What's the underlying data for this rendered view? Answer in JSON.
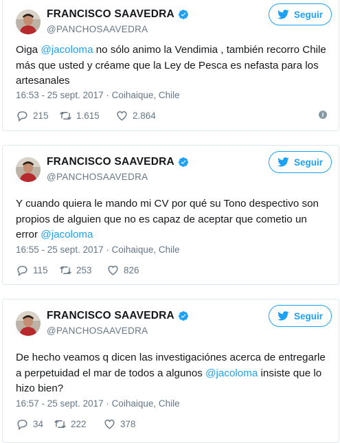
{
  "colors": {
    "accent": "#1da1f2",
    "muted": "#657786",
    "text": "#14171a",
    "border": "#e1e8ed"
  },
  "tweets": [
    {
      "name": "FRANCISCO SAAVEDRA",
      "handle": "@PANCHOSAAVEDRA",
      "follow_label": "Seguir",
      "text_parts": [
        "Oiga ",
        "@jacoloma",
        " no sólo animo la Vendimia , también recorro Chile más que usted y créame que la Ley de Pesca es nefasta para los artesanales"
      ],
      "meta": "16:53 - 25 sept. 2017 · Coihaique, Chile",
      "replies": "215",
      "retweets": "1.615",
      "likes": "2.864"
    },
    {
      "name": "FRANCISCO SAAVEDRA",
      "handle": "@PANCHOSAAVEDRA",
      "follow_label": "Seguir",
      "text_parts": [
        "Y cuando quiera le mando mi CV por qué su Tono despectivo son propios de alguien que no es capaz de aceptar que cometio un error ",
        "@jacoloma",
        ""
      ],
      "meta": "16:55 - 25 sept. 2017 · Coihaique, Chile",
      "replies": "115",
      "retweets": "253",
      "likes": "826"
    },
    {
      "name": "FRANCISCO SAAVEDRA",
      "handle": "@PANCHOSAAVEDRA",
      "follow_label": "Seguir",
      "text_parts": [
        "De hecho veamos q dicen las investigaciónes acerca de entregarle a perpetuidad el mar de todos a algunos ",
        "@jacoloma",
        " insiste que lo hizo bien?"
      ],
      "meta": "16:57 - 25 sept. 2017 · Coihaique, Chile",
      "replies": "34",
      "retweets": "222",
      "likes": "378"
    }
  ]
}
